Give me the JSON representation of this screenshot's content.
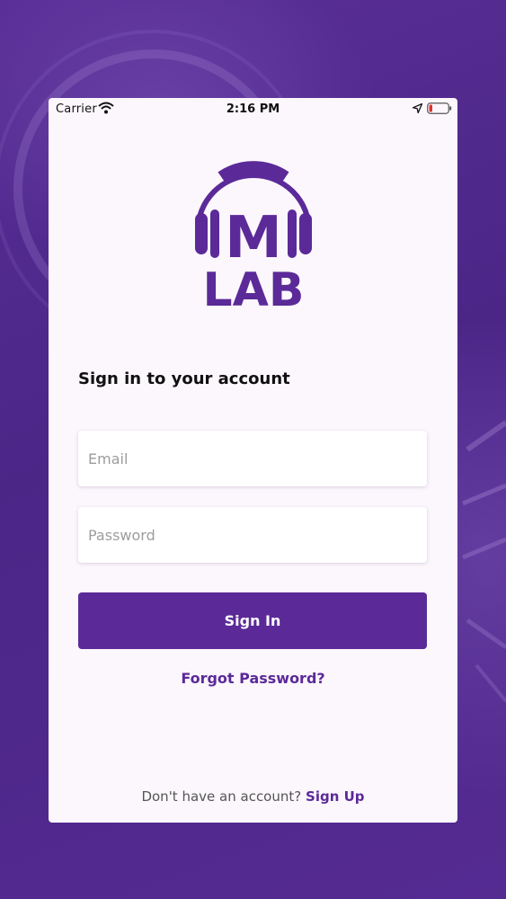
{
  "status_bar": {
    "carrier": "Carrier",
    "time": "2:16 PM",
    "wifi_icon": "wifi-icon",
    "location_icon": "location-arrow-icon",
    "battery_icon": "battery-low-icon"
  },
  "logo": {
    "top_text": "M",
    "bottom_text": "LAB",
    "icon": "headphones-icon"
  },
  "heading": "Sign in to your account",
  "form": {
    "email_placeholder": "Email",
    "password_placeholder": "Password",
    "signin_label": "Sign In",
    "forgot_label": "Forgot Password?"
  },
  "signup": {
    "prompt": "Don't have an account?",
    "link_label": "Sign Up"
  },
  "colors": {
    "brand_purple": "#5b2a98",
    "background_purple": "#4a2584",
    "card_background": "#fcf7fd",
    "battery_red": "#e0342b"
  }
}
